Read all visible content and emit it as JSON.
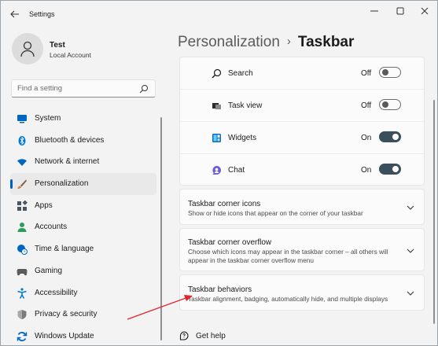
{
  "titlebar": {
    "app_title": "Settings",
    "back_icon": "arrow-left-icon",
    "controls": [
      "minimize-icon",
      "maximize-icon",
      "close-icon"
    ]
  },
  "profile": {
    "name": "Test",
    "account_type": "Local Account"
  },
  "search": {
    "placeholder": "Find a setting"
  },
  "sidebar": {
    "items": [
      {
        "label": "System",
        "icon": "monitor-icon",
        "color": "#0067c0"
      },
      {
        "label": "Bluetooth & devices",
        "icon": "bluetooth-icon",
        "color": "#0078d4"
      },
      {
        "label": "Network & internet",
        "icon": "wifi-icon",
        "color": "#0067c0"
      },
      {
        "label": "Personalization",
        "icon": "brush-icon",
        "color": "#d97b3b",
        "active": true
      },
      {
        "label": "Apps",
        "icon": "apps-icon",
        "color": "#4a5560"
      },
      {
        "label": "Accounts",
        "icon": "person-icon",
        "color": "#2a9d5c"
      },
      {
        "label": "Time & language",
        "icon": "globe-clock-icon",
        "color": "#0067c0"
      },
      {
        "label": "Gaming",
        "icon": "gamepad-icon",
        "color": "#5b5b5b"
      },
      {
        "label": "Accessibility",
        "icon": "accessibility-icon",
        "color": "#0078d4"
      },
      {
        "label": "Privacy & security",
        "icon": "shield-icon",
        "color": "#6b6b6b"
      },
      {
        "label": "Windows Update",
        "icon": "sync-icon",
        "color": "#0067c0"
      }
    ]
  },
  "breadcrumb": {
    "parent": "Personalization",
    "separator": "›",
    "current": "Taskbar"
  },
  "taskbar_items": [
    {
      "label": "Search",
      "state": "Off",
      "on": false,
      "icon": "search-icon"
    },
    {
      "label": "Task view",
      "state": "Off",
      "on": false,
      "icon": "task-view-icon"
    },
    {
      "label": "Widgets",
      "state": "On",
      "on": true,
      "icon": "widgets-icon"
    },
    {
      "label": "Chat",
      "state": "On",
      "on": true,
      "icon": "chat-icon"
    }
  ],
  "sections": [
    {
      "title": "Taskbar corner icons",
      "description": "Show or hide icons that appear on the corner of your taskbar"
    },
    {
      "title": "Taskbar corner overflow",
      "description": "Choose which icons may appear in the taskbar corner – all others will appear in the taskbar corner overflow menu"
    },
    {
      "title": "Taskbar behaviors",
      "description": "Taskbar alignment, badging, automatically hide, and multiple displays"
    }
  ],
  "help": {
    "label": "Get help",
    "icon": "help-icon"
  },
  "colors": {
    "accent": "#005fb8",
    "toggle_on": "#3a4e5c",
    "annotation_arrow": "#e0262b"
  }
}
